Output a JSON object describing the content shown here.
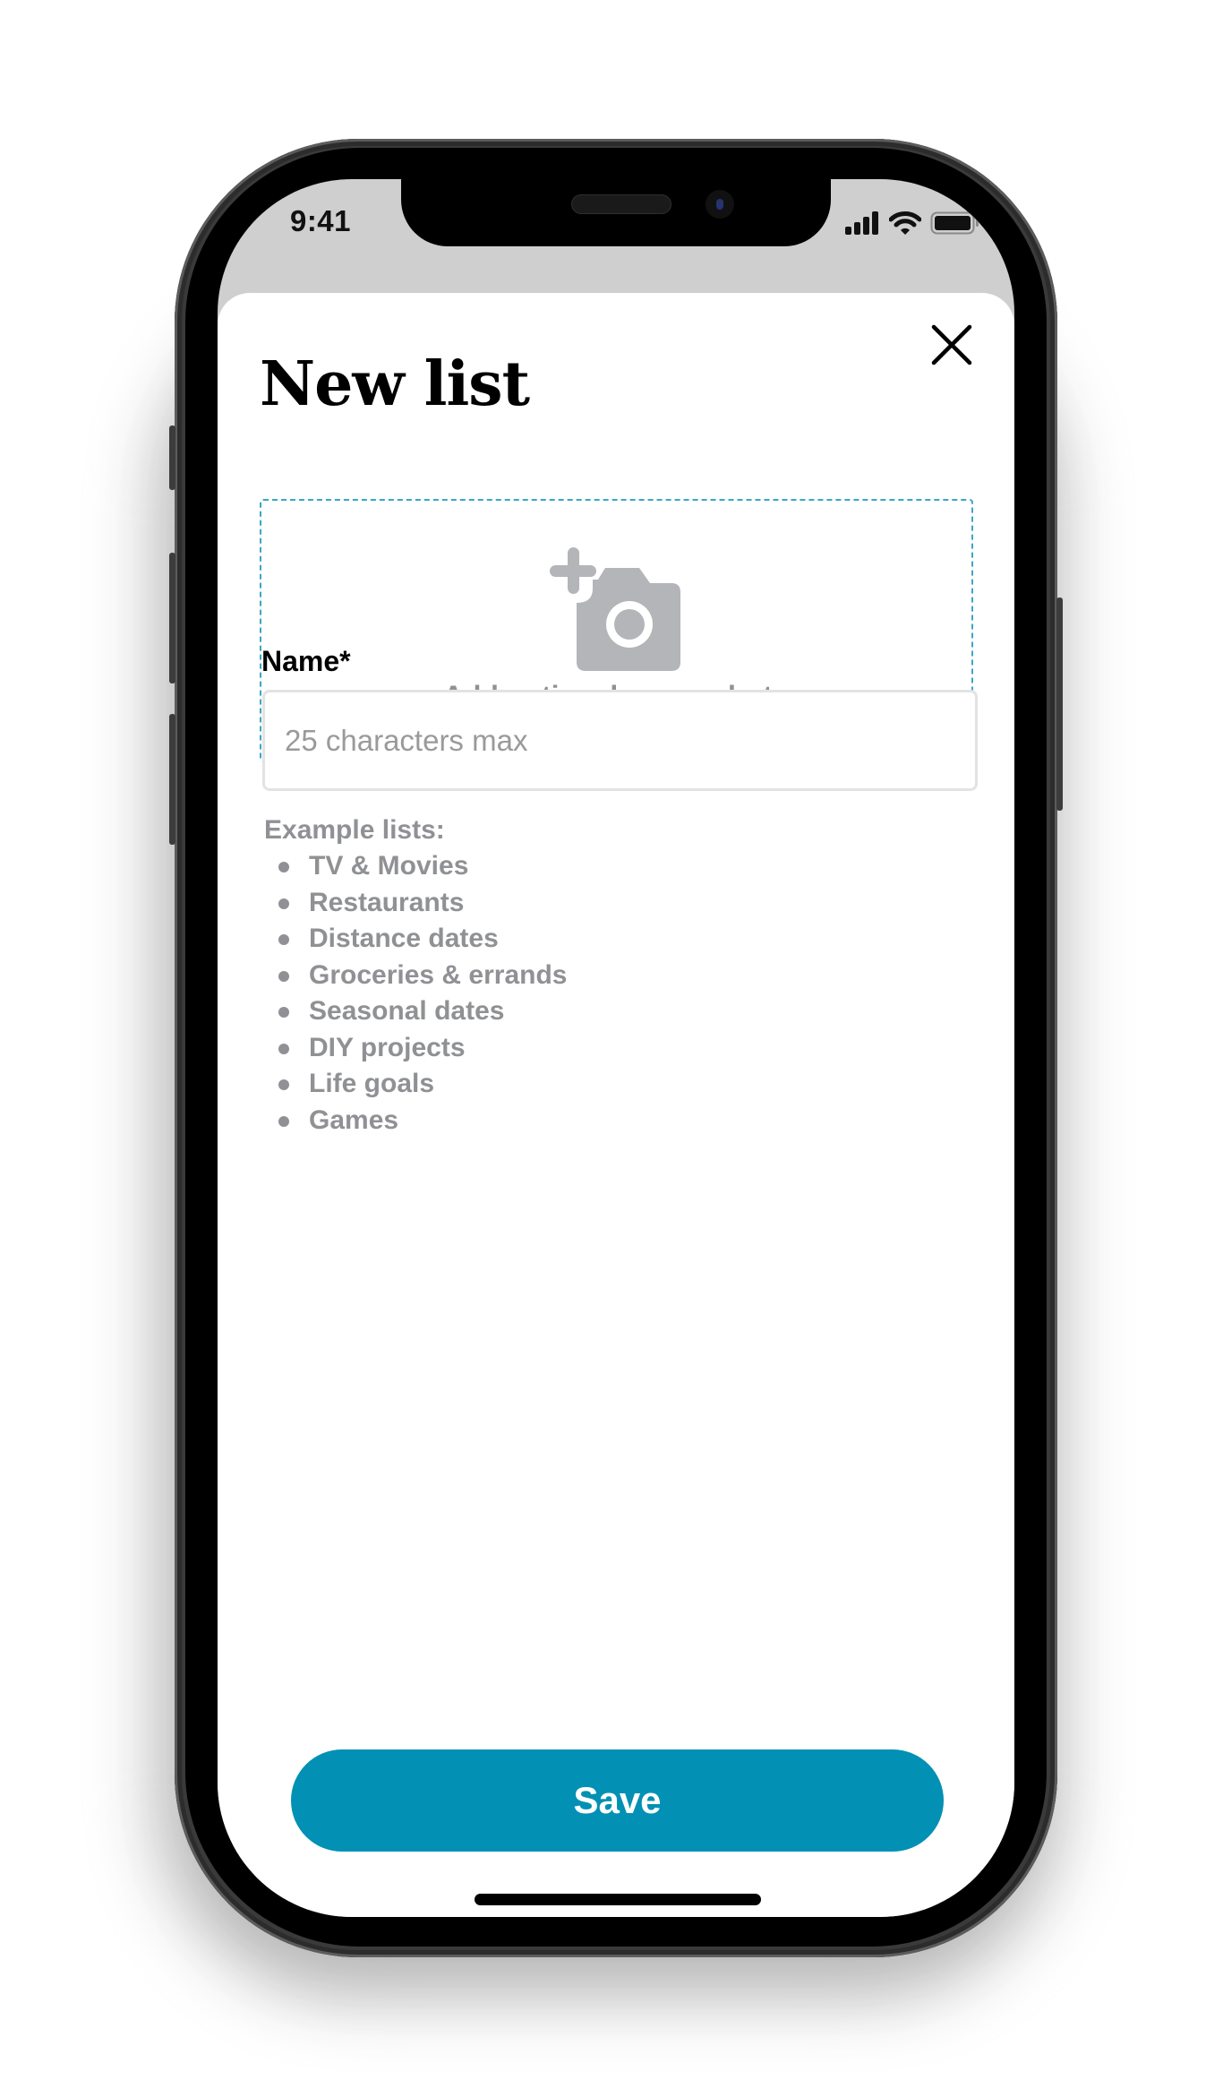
{
  "status_bar": {
    "time": "9:41",
    "icons": [
      "cellular-signal-icon",
      "wifi-icon",
      "battery-icon"
    ]
  },
  "sheet": {
    "title": "New list",
    "close_icon": "close-icon",
    "cover_photo": {
      "icon": "add-photo-camera-icon",
      "label": "Add optional cover photo"
    },
    "name_field": {
      "label": "Name*",
      "value": "",
      "placeholder": "25 characters max"
    },
    "examples": {
      "title": "Example lists:",
      "items": [
        "TV & Movies",
        "Restaurants",
        "Distance dates",
        "Groceries & errands",
        "Seasonal dates",
        "DIY projects",
        "Life goals",
        "Games"
      ]
    },
    "save_label": "Save"
  },
  "colors": {
    "accent": "#0291b4",
    "dashed_border": "#3aa7c3",
    "muted_text": "#8f9194",
    "status_bar_bg": "#cfcfcf",
    "icon_gray": "#b4b5b8"
  }
}
